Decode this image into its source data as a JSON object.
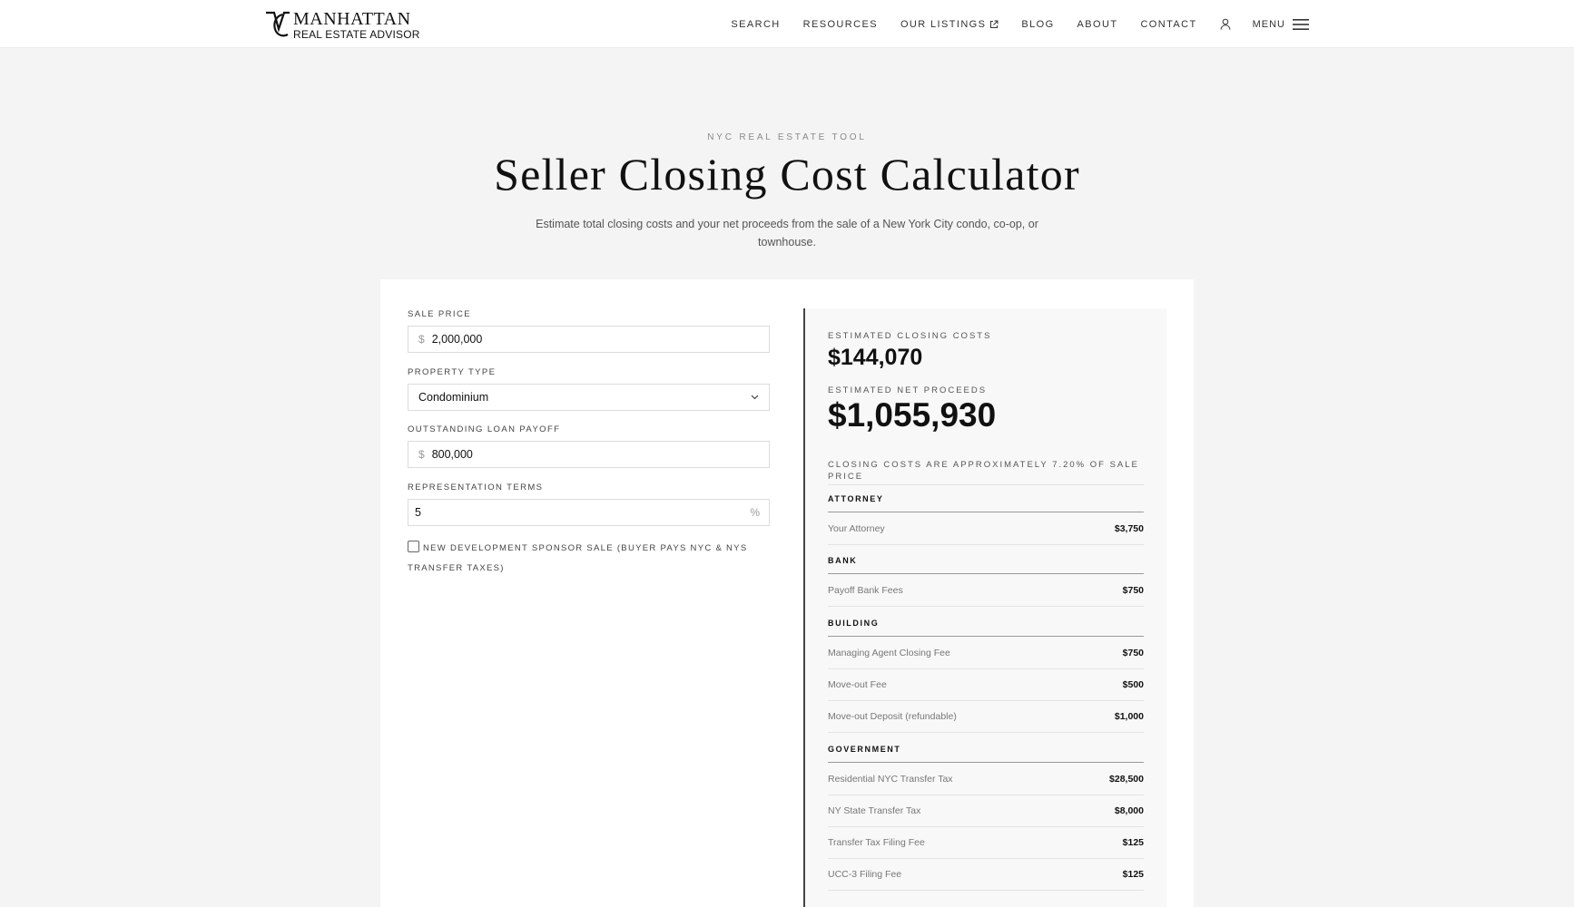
{
  "header": {
    "logo_line1": "MANHATTAN",
    "logo_line2": "REAL ESTATE ADVISOR",
    "nav": [
      {
        "label": "SEARCH"
      },
      {
        "label": "RESOURCES"
      },
      {
        "label": "OUR LISTINGS"
      },
      {
        "label": "BLOG"
      },
      {
        "label": "ABOUT"
      },
      {
        "label": "CONTACT"
      }
    ],
    "menu_label": "MENU"
  },
  "hero": {
    "eyebrow": "NYC REAL ESTATE TOOL",
    "title": "Seller Closing Cost Calculator",
    "description": "Estimate total closing costs and your net proceeds from the sale of a New York City condo, co-op, or townhouse."
  },
  "form": {
    "sale_price_label": "SALE PRICE",
    "currency_symbol": "$",
    "sale_price_value": "2,000,000",
    "property_type_label": "PROPERTY TYPE",
    "property_type_value": "Condominium",
    "loan_label": "OUTSTANDING LOAN PAYOFF",
    "loan_value": "800,000",
    "rep_label": "REPRESENTATION TERMS",
    "rep_value": "5",
    "percent_symbol": "%",
    "sponsor_checkbox_label": "NEW DEVELOPMENT SPONSOR SALE (BUYER PAYS NYC & NYS TRANSFER TAXES)"
  },
  "results": {
    "closing_costs_label": "ESTIMATED CLOSING COSTS",
    "closing_costs_value": "$144,070",
    "net_proceeds_label": "ESTIMATED NET PROCEEDS",
    "net_proceeds_value": "$1,055,930",
    "note": "CLOSING COSTS ARE APPROXIMATELY 7.20% OF SALE PRICE",
    "sections": [
      {
        "title": "ATTORNEY",
        "rows": [
          {
            "label": "Your Attorney",
            "amount": "$3,750"
          }
        ]
      },
      {
        "title": "BANK",
        "rows": [
          {
            "label": "Payoff Bank Fees",
            "amount": "$750"
          }
        ]
      },
      {
        "title": "BUILDING",
        "rows": [
          {
            "label": "Managing Agent Closing Fee",
            "amount": "$750"
          },
          {
            "label": "Move-out Fee",
            "amount": "$500"
          },
          {
            "label": "Move-out Deposit (refundable)",
            "amount": "$1,000"
          }
        ]
      },
      {
        "title": "GOVERNMENT",
        "rows": [
          {
            "label": "Residential NYC Transfer Tax",
            "amount": "$28,500"
          },
          {
            "label": "NY State Transfer Tax",
            "amount": "$8,000"
          },
          {
            "label": "Transfer Tax Filing Fee",
            "amount": "$125"
          },
          {
            "label": "UCC-3 Filing Fee",
            "amount": "$125"
          }
        ]
      }
    ]
  }
}
